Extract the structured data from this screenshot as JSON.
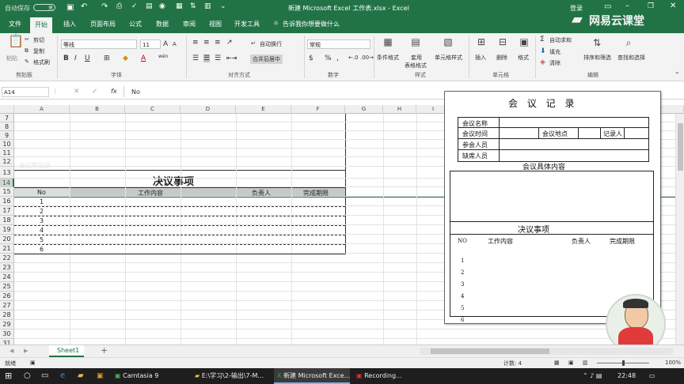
{
  "titlebar": {
    "autosave": "自动保存",
    "autosave_state": "关",
    "title": "新建 Microsoft Excel 工作表.xlsx - Excel",
    "login": "登录"
  },
  "tabs": [
    "文件",
    "开始",
    "插入",
    "页面布局",
    "公式",
    "数据",
    "审阅",
    "视图",
    "开发工具"
  ],
  "active_tab": "开始",
  "tell_me": "告诉我你想要做什么",
  "brand": "网易云课堂",
  "ribbon": {
    "clipboard": {
      "paste": "粘贴",
      "cut": "剪切",
      "copy": "复制",
      "painter": "格式刷",
      "group": "剪贴板"
    },
    "font": {
      "name": "等线",
      "size": "11",
      "group": "字体",
      "bold": "B",
      "italic": "I",
      "underline": "U",
      "grow": "A",
      "shrink": "A",
      "wen": "wén"
    },
    "align": {
      "wrap": "自动换行",
      "merge": "合并后居中",
      "group": "对齐方式"
    },
    "number": {
      "format": "常规",
      "percent": "%",
      "comma": ",",
      "group": "数字"
    },
    "styles": {
      "cond": "条件格式",
      "table1": "套用",
      "table2": "表格格式",
      "cell": "单元格样式",
      "group": "样式"
    },
    "cells": {
      "insert": "插入",
      "delete": "删除",
      "format": "格式",
      "group": "单元格"
    },
    "editing": {
      "autosum": "自动求和",
      "fill": "填充",
      "clear": "清除",
      "sort": "排序和筛选",
      "find": "查找和选择",
      "group": "编辑"
    }
  },
  "formula": {
    "namebox": "A14",
    "fx": "fx",
    "content": "No"
  },
  "grid": {
    "columns": [
      "A",
      "B",
      "C",
      "D",
      "E",
      "F",
      "G",
      "H",
      "I"
    ],
    "rows": [
      "7",
      "8",
      "9",
      "10",
      "11",
      "12",
      "13",
      "14",
      "15",
      "16",
      "17",
      "18",
      "19",
      "20",
      "21",
      "22",
      "23",
      "24",
      "25",
      "26",
      "27",
      "28",
      "29",
      "30",
      "31"
    ],
    "faint_text": "会议和记录",
    "title": "决议事项",
    "header": [
      "No",
      "工作内容",
      "负责人",
      "完成期限"
    ],
    "numbers": [
      "1",
      "2",
      "3",
      "4",
      "5",
      "6"
    ]
  },
  "sheet": {
    "tab": "Sheet1",
    "add": "+"
  },
  "status": {
    "ready": "就绪",
    "count": "计数: 4",
    "zoom": "100%"
  },
  "taskbar": {
    "items": [
      "Camtasia 9",
      "E:\\学习\\2-输出\\7-M...",
      "新建 Microsoft Exce...",
      "Recording..."
    ],
    "time": "22:48"
  },
  "paper": {
    "title": "会 议 记 录",
    "labels": [
      "会议名称",
      "会议时间",
      "参会人员",
      "缺席人员"
    ],
    "place": "会议地点",
    "recorder": "记录人",
    "content": "会议具体内容",
    "decision": "决议事项",
    "cols": [
      "NO",
      "工作内容",
      "负责人",
      "完成期限"
    ],
    "nums": [
      "1",
      "2",
      "3",
      "4",
      "5",
      "6"
    ]
  },
  "colors": {
    "excel_green": "#217346",
    "ribbon_bg": "#f3f3f3",
    "selected_row": "#217346",
    "taskbar": "#1e1e1e"
  }
}
